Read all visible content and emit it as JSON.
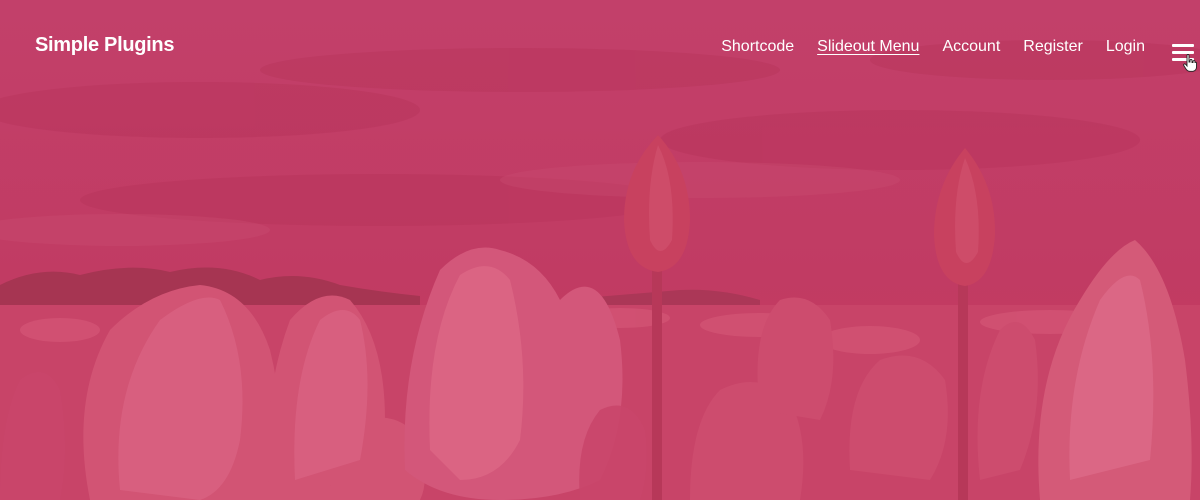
{
  "site": {
    "title": "Simple Plugins"
  },
  "nav": {
    "items": [
      {
        "label": "Shortcode",
        "current": false
      },
      {
        "label": "Slideout Menu",
        "current": true
      },
      {
        "label": "Account",
        "current": false
      },
      {
        "label": "Register",
        "current": false
      },
      {
        "label": "Login",
        "current": false
      }
    ]
  },
  "menu_toggle": {
    "icon": "hamburger-icon"
  },
  "cursor": {
    "icon": "hand-pointer-icon"
  },
  "colors": {
    "overlay": "#c13e63",
    "text": "#ffffff"
  }
}
